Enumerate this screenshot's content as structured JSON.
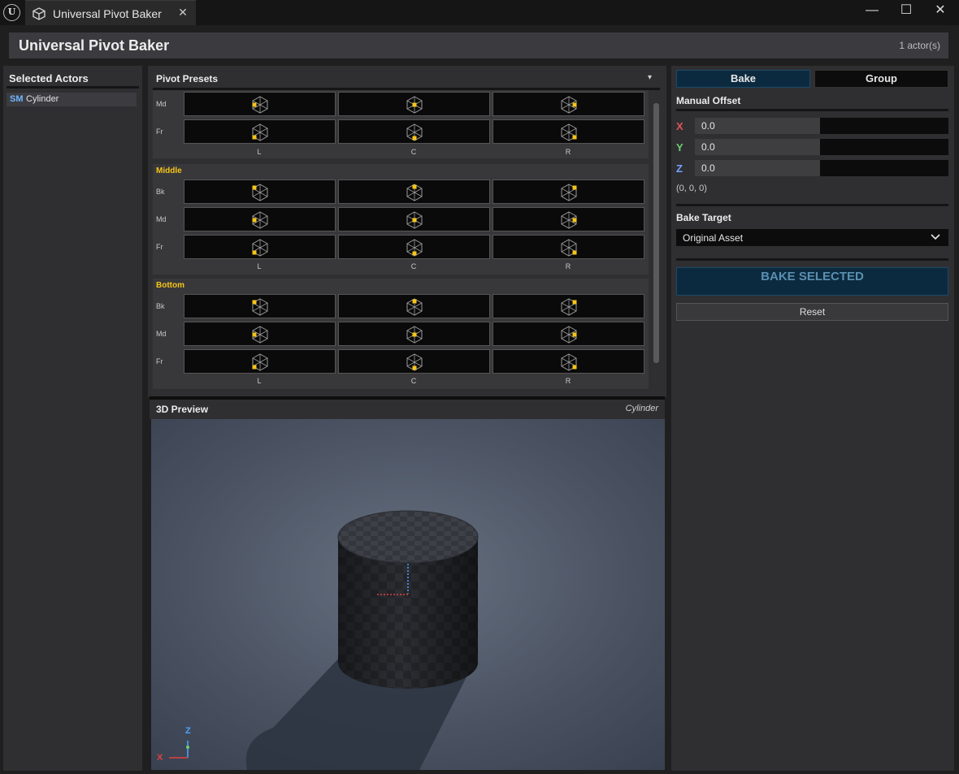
{
  "window": {
    "tab_title": "Universal Pivot Baker",
    "close_glyph": "✕",
    "min_glyph": "—",
    "max_glyph": "☐",
    "winclose_glyph": "✕"
  },
  "header": {
    "title": "Universal Pivot Baker",
    "count": "1 actor(s)"
  },
  "left": {
    "title": "Selected Actors",
    "actors": [
      {
        "type": "SM",
        "name": "Cylinder"
      }
    ]
  },
  "presets": {
    "title": "Pivot Presets",
    "dropdown_glyph": "▾",
    "columns": [
      "L",
      "C",
      "R"
    ],
    "partial_group": {
      "rows": [
        "Md",
        "Fr"
      ]
    },
    "groups": [
      {
        "title": "Middle",
        "rows": [
          "Bk",
          "Md",
          "Fr"
        ]
      },
      {
        "title": "Bottom",
        "rows": [
          "Bk",
          "Md",
          "Fr"
        ]
      }
    ]
  },
  "preview": {
    "title": "3D Preview",
    "object": "Cylinder",
    "gizmo": {
      "z": "Z",
      "x": "X"
    }
  },
  "right": {
    "tabs": [
      "Bake",
      "Group"
    ],
    "active_tab": "Bake",
    "offset_title": "Manual Offset",
    "offset": {
      "x": {
        "label": "X",
        "value": "0.0"
      },
      "y": {
        "label": "Y",
        "value": "0.0"
      },
      "z": {
        "label": "Z",
        "value": "0.0"
      },
      "summary": "(0, 0, 0)"
    },
    "target_title": "Bake Target",
    "target_value": "Original Asset",
    "bake_button": "BAKE SELECTED",
    "reset_button": "Reset"
  },
  "colors": {
    "accent": "#f5c518",
    "x_axis": "#e05555",
    "y_axis": "#6fcf6f",
    "z_axis": "#7aa2ff",
    "bake_button_bg": "#0c2a3f",
    "bake_button_text": "#5a8fb0"
  }
}
